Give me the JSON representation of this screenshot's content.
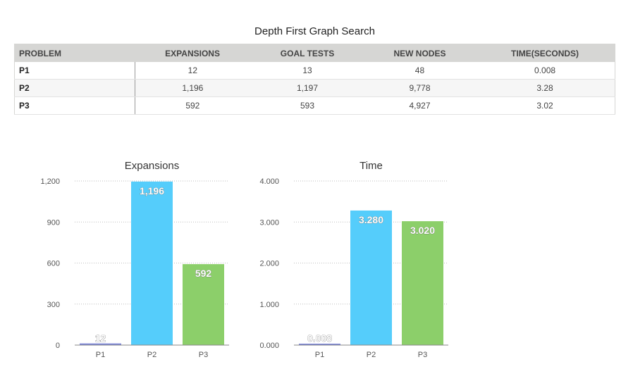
{
  "table": {
    "title": "Depth First Graph Search",
    "headers": [
      "PROBLEM",
      "EXPANSIONS",
      "GOAL TESTS",
      "NEW NODES",
      "TIME(SECONDS)"
    ],
    "rows": [
      [
        "P1",
        "12",
        "13",
        "48",
        "0.008"
      ],
      [
        "P2",
        "1,196",
        "1,197",
        "9,778",
        "3.28"
      ],
      [
        "P3",
        "592",
        "593",
        "4,927",
        "3.02"
      ]
    ]
  },
  "chart_data": [
    {
      "type": "bar",
      "title": "Expansions",
      "categories": [
        "P1",
        "P2",
        "P3"
      ],
      "values": [
        12,
        1196,
        592
      ],
      "value_labels": [
        "12",
        "1,196",
        "592"
      ],
      "colors": [
        "#7b84d8",
        "#55cdfb",
        "#8ccf6a"
      ],
      "ylim": [
        0,
        1200
      ],
      "yticks": [
        "0",
        "300",
        "600",
        "900",
        "1,200"
      ],
      "grid": true
    },
    {
      "type": "bar",
      "title": "Time",
      "categories": [
        "P1",
        "P2",
        "P3"
      ],
      "values": [
        0.008,
        3.28,
        3.02
      ],
      "value_labels": [
        "0.008",
        "3.280",
        "3.020"
      ],
      "colors": [
        "#7b84d8",
        "#55cdfb",
        "#8ccf6a"
      ],
      "ylim": [
        0,
        4
      ],
      "yticks": [
        "0.000",
        "1.000",
        "2.000",
        "3.000",
        "4.000"
      ],
      "grid": true
    }
  ]
}
